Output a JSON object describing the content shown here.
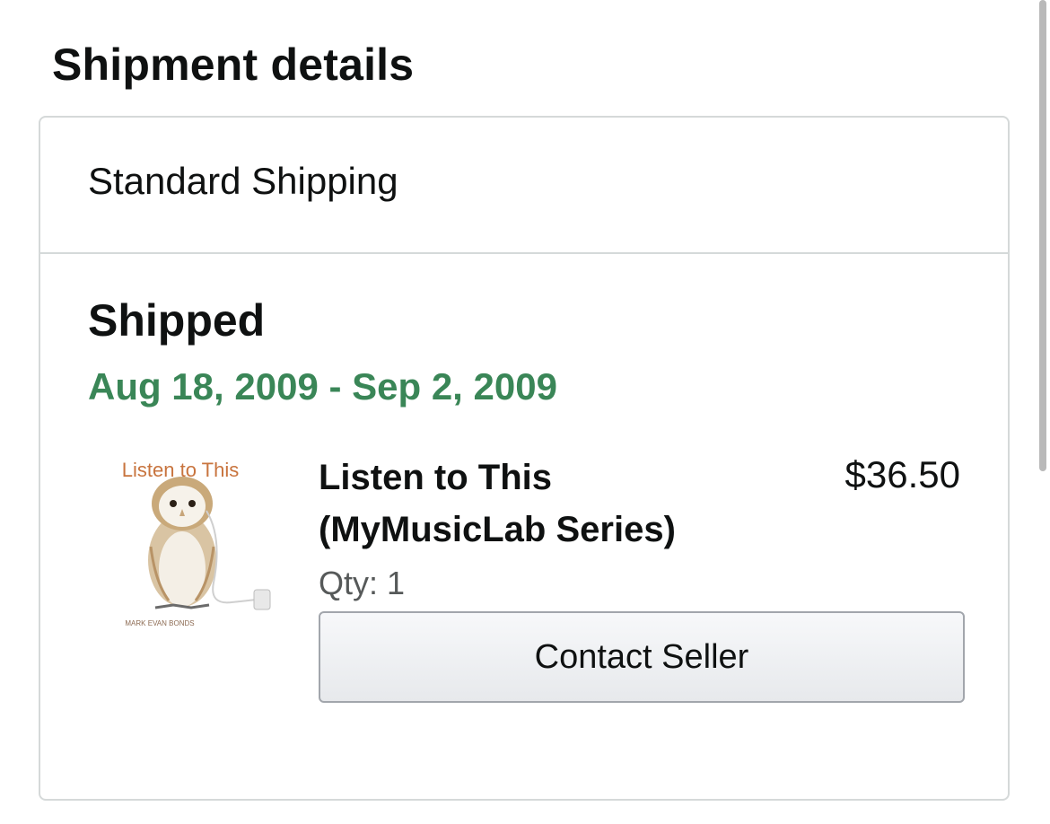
{
  "section": {
    "title": "Shipment details"
  },
  "shipment": {
    "method": "Standard Shipping",
    "status": "Shipped",
    "date_range": "Aug 18, 2009 - Sep 2, 2009",
    "status_color": "#3a8657"
  },
  "item": {
    "title": "Listen to This (MyMusicLab Series)",
    "price": "$36.50",
    "quantity": "Qty: 1",
    "cover": {
      "title_text": "Listen to This",
      "author_text": "MARK EVAN BONDS",
      "icon": "owl-book-cover"
    }
  },
  "actions": {
    "contact_seller_label": "Contact Seller"
  }
}
